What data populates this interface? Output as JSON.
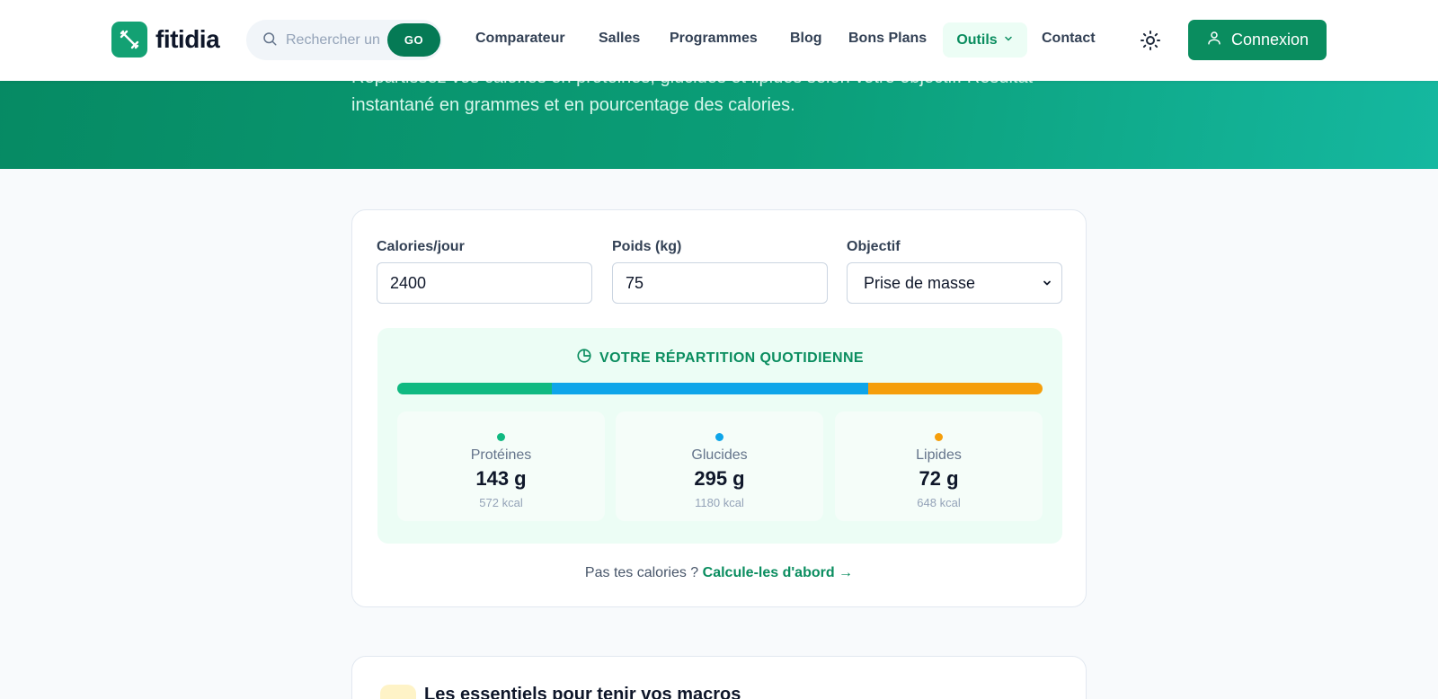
{
  "header": {
    "logo_text": "fitidia",
    "search": {
      "placeholder": "Rechercher un",
      "go_label": "GO"
    },
    "nav": {
      "comparateur": "Comparateur",
      "salles": "Salles",
      "programmes": "Programmes",
      "blog": "Blog",
      "bons_plans": "Bons Plans",
      "outils": "Outils",
      "contact": "Contact"
    },
    "login_label": "Connexion"
  },
  "hero": {
    "description": "Répartissez vos calories en protéines, glucides et lipides selon votre objectif. Résultat instantané en grammes et en pourcentage des calories."
  },
  "form": {
    "calories_label": "Calories/jour",
    "calories_value": "2400",
    "weight_label": "Poids (kg)",
    "weight_value": "75",
    "goal_label": "Objectif",
    "goal_value": "Prise de masse"
  },
  "result": {
    "title": "VOTRE RÉPARTITION QUOTIDIENNE",
    "shares": {
      "proteines": 0.24,
      "glucides": 0.49,
      "lipides": 0.27
    },
    "proteines": {
      "label": "Protéines",
      "value": "143 g",
      "kcal": "572 kcal",
      "color": "#10b981"
    },
    "glucides": {
      "label": "Glucides",
      "value": "295 g",
      "kcal": "1180 kcal",
      "color": "#0ea5e9"
    },
    "lipides": {
      "label": "Lipides",
      "value": "72 g",
      "kcal": "648 kcal",
      "color": "#f59e0b"
    }
  },
  "footer": {
    "prefix": "Pas tes calories ?",
    "link": "Calcule-les d'abord →"
  },
  "essentials": {
    "title": "Les essentiels pour tenir vos macros"
  }
}
